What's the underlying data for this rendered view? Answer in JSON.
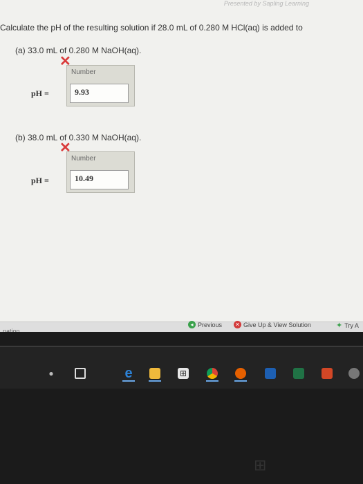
{
  "header": {
    "credit": "Presented by Sapling Learning"
  },
  "question": {
    "text": "Calculate the pH of the resulting solution if 28.0 mL of 0.280 M HCl(aq) is added to"
  },
  "parts": [
    {
      "label": "(a) 33.0 mL of 0.280 M NaOH(aq).",
      "box_header": "Number",
      "ph_label": "pH =",
      "value": "9.93",
      "status_icon": "red-x-icon"
    },
    {
      "label": "(b) 38.0 mL of 0.330 M NaOH(aq).",
      "box_header": "Number",
      "ph_label": "pH =",
      "value": "10.49",
      "status_icon": "red-x-icon"
    }
  ],
  "footer": {
    "left_text": "nation",
    "previous": "Previous",
    "give_up": "Give Up & View Solution",
    "try_again": "Try A"
  },
  "taskbar": {
    "icons": [
      "microphone-icon",
      "task-view-icon",
      "edge-icon",
      "file-explorer-icon",
      "store-icon",
      "chrome-icon",
      "firefox-icon",
      "outlook-icon",
      "excel-icon",
      "powerpoint-icon",
      "extra-app-icon"
    ]
  },
  "colors": {
    "error_red": "#d93a3a",
    "link_green": "#3aa14b",
    "page_bg": "#f1f1ee"
  }
}
